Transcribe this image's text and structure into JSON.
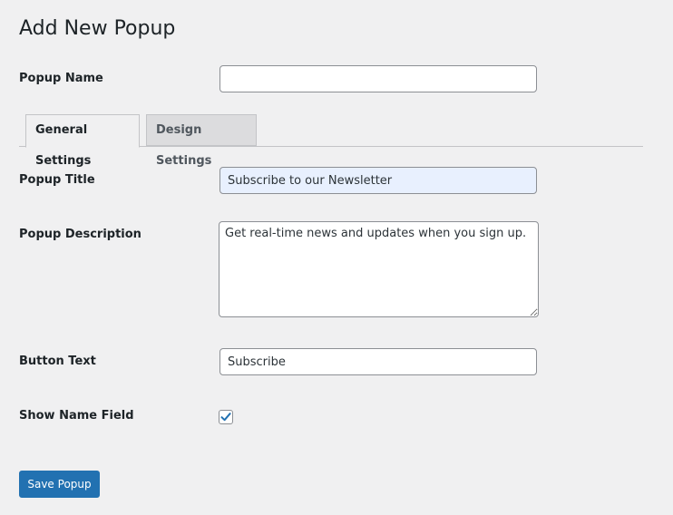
{
  "page": {
    "title": "Add New Popup"
  },
  "form": {
    "popup_name": {
      "label": "Popup Name",
      "value": ""
    },
    "tabs": [
      {
        "label": "General Settings",
        "active": true
      },
      {
        "label": "Design Settings",
        "active": false
      }
    ],
    "popup_title": {
      "label": "Popup Title",
      "value": "Subscribe to our Newsletter"
    },
    "popup_description": {
      "label": "Popup Description",
      "value": "Get real-time news and updates when you sign up."
    },
    "button_text": {
      "label": "Button Text",
      "value": "Subscribe"
    },
    "show_name_field": {
      "label": "Show Name Field",
      "checked": true
    },
    "save_label": "Save Popup"
  },
  "colors": {
    "accent": "#2271b1",
    "background": "#f0f0f1",
    "autofill": "#e8f0fe"
  },
  "icons": {
    "checkbox": "checkmark-icon"
  }
}
